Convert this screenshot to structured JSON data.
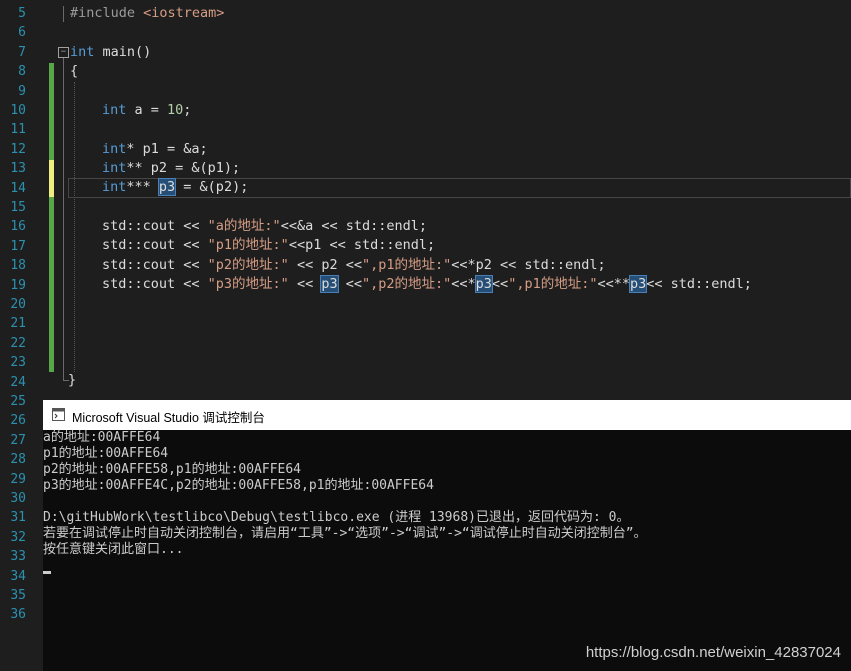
{
  "editor": {
    "line_numbers": [
      "5",
      "6",
      "7",
      "8",
      "9",
      "10",
      "11",
      "12",
      "13",
      "14",
      "15",
      "16",
      "17",
      "18",
      "19",
      "20",
      "21",
      "22",
      "23",
      "24",
      "25",
      "26",
      "27",
      "28",
      "29",
      "30",
      "31",
      "32",
      "33",
      "34",
      "35",
      "36"
    ],
    "code": {
      "l5_include": "#include ",
      "l5_header": "<iostream>",
      "l7_kw": "int",
      "l7_rest": " main()",
      "l8": "{",
      "l10_kw": "int",
      "l10_mid": " a = ",
      "l10_num": "10",
      "l10_end": ";",
      "l12_kw": "int",
      "l12_rest": "* p1 = &a;",
      "l13_kw": "int",
      "l13_rest": "** p2 = &(p1);",
      "l14_kw": "int",
      "l14_mid": "*** ",
      "l14_hl": "p3",
      "l14_end": " = &(p2);",
      "l16_a": "std::cout << ",
      "l16_s": "\"a的地址:\"",
      "l16_b": "<<&a << std::endl;",
      "l17_a": "std::cout << ",
      "l17_s": "\"p1的地址:\"",
      "l17_b": "<<p1 << std::endl;",
      "l18_a": "std::cout << ",
      "l18_s1": "\"p2的地址:\"",
      "l18_b": " << p2 <<",
      "l18_s2": "\",p1的地址:\"",
      "l18_c": "<<*p2 << std::endl;",
      "l19_a": "std::cout << ",
      "l19_s1": "\"p3的地址:\"",
      "l19_b": " << ",
      "l19_hl1": "p3",
      "l19_c": " <<",
      "l19_s2": "\",p2的地址:\"",
      "l19_d": "<<*",
      "l19_hl2": "p3",
      "l19_e": "<<",
      "l19_s3": "\",p1的地址:\"",
      "l19_f": "<<**",
      "l19_hl3": "p3",
      "l19_g": "<< std::endl;",
      "l24": "}"
    }
  },
  "console": {
    "title": "Microsoft Visual Studio 调试控制台",
    "lines": [
      "a的地址:00AFFE64",
      "p1的地址:00AFFE64",
      "p2的地址:00AFFE58,p1的地址:00AFFE64",
      "p3的地址:00AFFE4C,p2的地址:00AFFE58,p1的地址:00AFFE64",
      "",
      "D:\\gitHubWork\\testlibco\\Debug\\testlibco.exe (进程 13968)已退出，返回代码为: 0。",
      "若要在调试停止时自动关闭控制台，请启用“工具”->“选项”->“调试”->“调试停止时自动关闭控制台”。",
      "按任意键关闭此窗口..."
    ]
  },
  "watermark": "https://blog.csdn.net/weixin_42837024",
  "colors": {
    "background": "#1e1e1e",
    "line_number": "#2b91af",
    "keyword": "#569cd6",
    "string": "#d69d85",
    "change_bar_saved": "#57a64a",
    "change_bar_unsaved": "#eeee80"
  }
}
